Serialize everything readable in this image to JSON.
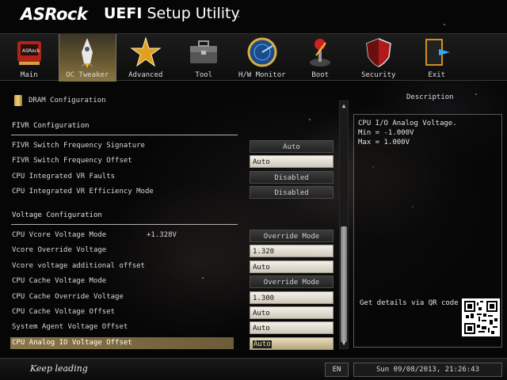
{
  "header": {
    "brand": "ASRock",
    "title_bold": "UEFI",
    "title_rest": "Setup Utility"
  },
  "tabs": [
    {
      "label": "Main",
      "icon": "main-icon"
    },
    {
      "label": "OC Tweaker",
      "icon": "rocket-icon",
      "active": true
    },
    {
      "label": "Advanced",
      "icon": "star-icon"
    },
    {
      "label": "Tool",
      "icon": "toolbox-icon"
    },
    {
      "label": "H/W Monitor",
      "icon": "radar-icon"
    },
    {
      "label": "Boot",
      "icon": "joystick-icon"
    },
    {
      "label": "Security",
      "icon": "shield-icon"
    },
    {
      "label": "Exit",
      "icon": "exit-door-icon"
    }
  ],
  "breadcrumb": "DRAM Configuration",
  "sections": {
    "fivr": "FIVR Configuration",
    "voltage": "Voltage Configuration"
  },
  "settings": [
    {
      "label": "FIVR Switch Frequency Signature",
      "value": "Auto",
      "kind": "button"
    },
    {
      "label": "FIVR Switch Frequency Offset",
      "value": "Auto",
      "kind": "input"
    },
    {
      "label": "CPU Integrated VR Faults",
      "value": "Disabled",
      "kind": "button"
    },
    {
      "label": "CPU Integrated VR Efficiency Mode",
      "value": "Disabled",
      "kind": "button"
    },
    {
      "label": "CPU Vcore Voltage Mode",
      "reading": "+1.328V",
      "value": "Override Mode",
      "kind": "button"
    },
    {
      "label": "Vcore Override Voltage",
      "value": "1.320",
      "kind": "input"
    },
    {
      "label": "Vcore voltage additional offset",
      "value": "Auto",
      "kind": "input"
    },
    {
      "label": "CPU Cache Voltage Mode",
      "value": "Override Mode",
      "kind": "button"
    },
    {
      "label": "CPU Cache Override Voltage",
      "value": "1.300",
      "kind": "input"
    },
    {
      "label": "CPU Cache Voltage Offset",
      "value": "Auto",
      "kind": "input"
    },
    {
      "label": "System Agent Voltage Offset",
      "value": "Auto",
      "kind": "input"
    },
    {
      "label": "CPU Analog IO Voltage Offset",
      "value": "Auto",
      "kind": "input",
      "selected": true
    }
  ],
  "description": {
    "title": "Description",
    "lines": [
      "CPU I/O Analog Voltage.",
      "Min = -1.000V",
      "Max = 1.000V"
    ],
    "qr_caption": "Get details via QR code"
  },
  "footer": {
    "slogan": "Keep leading",
    "language": "EN",
    "datetime": "Sun 09/08/2013, 21:26:43"
  },
  "colors": {
    "accent": "#8a7648",
    "highlight_tab": "#6a5a32",
    "field_bg": "#f0ece2"
  }
}
